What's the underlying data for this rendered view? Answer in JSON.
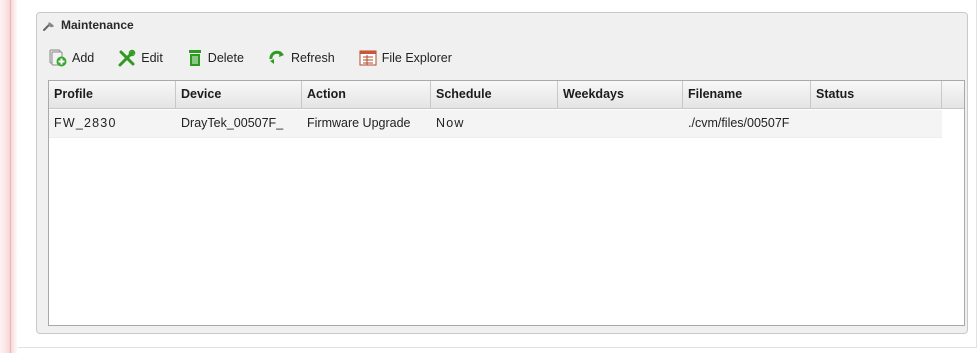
{
  "panel": {
    "title": "Maintenance",
    "title_icon": "wrench-icon"
  },
  "toolbar": {
    "add_label": "Add",
    "edit_label": "Edit",
    "delete_label": "Delete",
    "refresh_label": "Refresh",
    "file_explorer_label": "File Explorer"
  },
  "table": {
    "columns": [
      "Profile",
      "Device",
      "Action",
      "Schedule",
      "Weekdays",
      "Filename",
      "Status"
    ],
    "rows": [
      [
        "FW_2830",
        "DrayTek_00507F_",
        "Firmware Upgrade",
        "Now",
        "",
        "./cvm/files/00507F",
        ""
      ]
    ]
  },
  "colors": {
    "accent_green": "#3a9a2a",
    "side_strip": "#f6d3d3",
    "panel_bg": "#f0f0f0"
  }
}
